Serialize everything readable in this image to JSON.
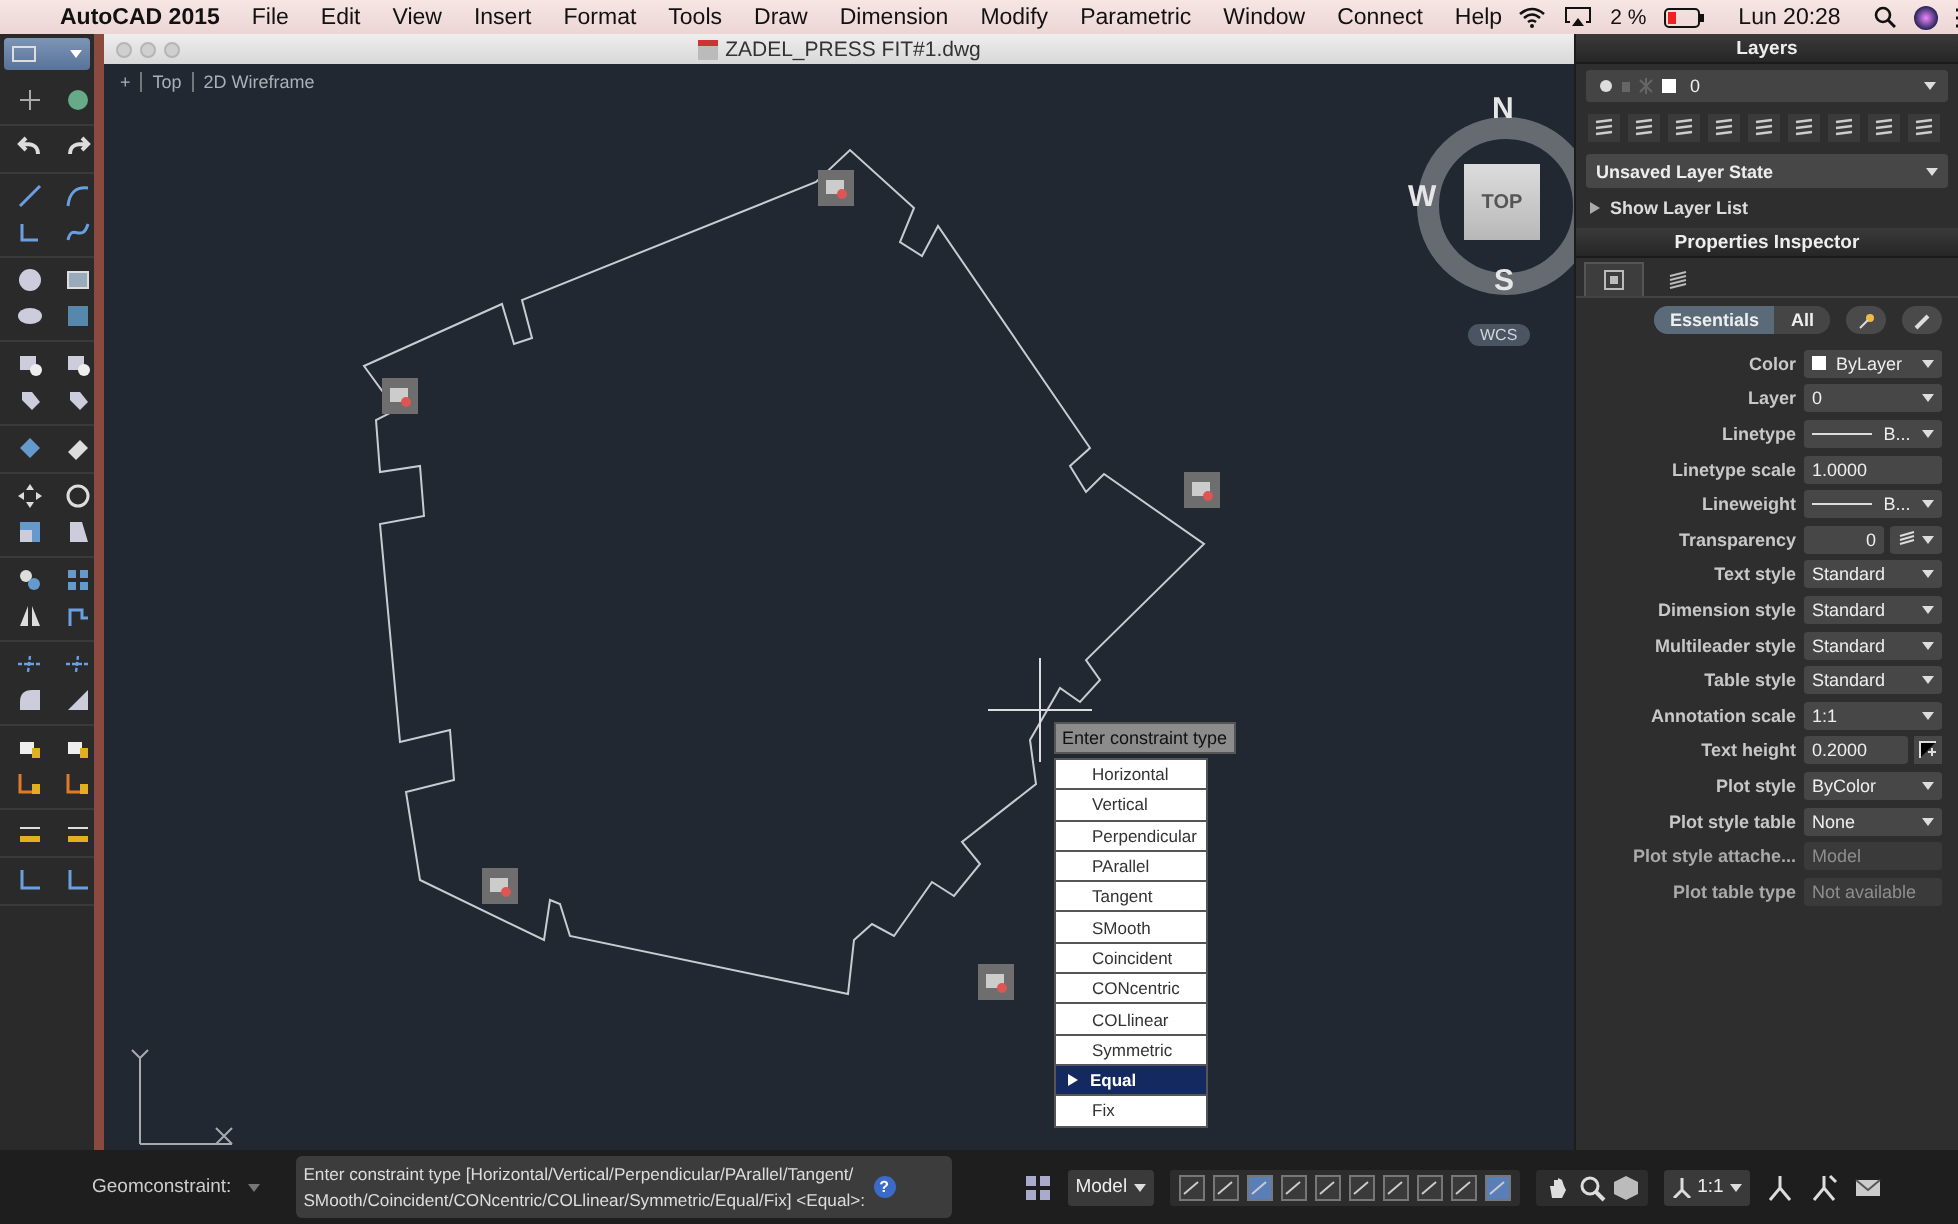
{
  "menu_bar": {
    "app_name": "AutoCAD 2015",
    "items": [
      "File",
      "Edit",
      "View",
      "Insert",
      "Format",
      "Tools",
      "Draw",
      "Dimension",
      "Modify",
      "Parametric",
      "Window",
      "Connect",
      "Help"
    ],
    "battery": "2 %",
    "clock": "Lun 20:28"
  },
  "document": {
    "title": "ZADEL_PRESS FIT#1.dwg",
    "viewport_controls": [
      "+",
      "Top",
      "2D Wireframe"
    ]
  },
  "viewcube": {
    "face": "TOP",
    "north": "N",
    "west": "W",
    "south": "S",
    "coordinate_system": "WCS"
  },
  "constraint_prompt": {
    "label": "Enter constraint type",
    "options": [
      {
        "label": "Horizontal",
        "selected": false
      },
      {
        "label": "Vertical",
        "selected": false
      },
      {
        "label": "Perpendicular",
        "selected": false
      },
      {
        "label": "PArallel",
        "selected": false
      },
      {
        "label": "Tangent",
        "selected": false
      },
      {
        "label": "SMooth",
        "selected": false
      },
      {
        "label": "Coincident",
        "selected": false
      },
      {
        "label": "CONcentric",
        "selected": false
      },
      {
        "label": "COLlinear",
        "selected": false
      },
      {
        "label": "Symmetric",
        "selected": false
      },
      {
        "label": "Equal",
        "selected": true
      },
      {
        "label": "Fix",
        "selected": false
      }
    ]
  },
  "layers_panel": {
    "title": "Layers",
    "current_layer": "0",
    "layer_state": "Unsaved Layer State",
    "show_layer_list": "Show Layer List"
  },
  "properties_inspector": {
    "title": "Properties Inspector",
    "tabs": [
      {
        "selected": true
      },
      {
        "selected": false
      }
    ],
    "modes": [
      {
        "label": "Essentials",
        "selected": true
      },
      {
        "label": "All",
        "selected": false
      }
    ],
    "rows": [
      {
        "label": "Color",
        "value": "ByLayer",
        "kind": "swatch"
      },
      {
        "label": "Layer",
        "value": "0",
        "kind": "dropdown"
      },
      {
        "label": "Linetype",
        "value": "B...",
        "kind": "line"
      },
      {
        "label": "Linetype scale",
        "value": "1.0000",
        "kind": "field"
      },
      {
        "label": "Lineweight",
        "value": "B...",
        "kind": "line"
      },
      {
        "label": "Transparency",
        "value": "0",
        "kind": "transparency"
      },
      {
        "label": "Text style",
        "value": "Standard",
        "kind": "dropdown"
      },
      {
        "label": "Dimension style",
        "value": "Standard",
        "kind": "dropdown"
      },
      {
        "label": "Multileader style",
        "value": "Standard",
        "kind": "dropdown"
      },
      {
        "label": "Table style",
        "value": "Standard",
        "kind": "dropdown"
      },
      {
        "label": "Annotation scale",
        "value": "1:1",
        "kind": "dropdown"
      },
      {
        "label": "Text height",
        "value": "0.2000",
        "kind": "pick"
      },
      {
        "label": "Plot style",
        "value": "ByColor",
        "kind": "dropdown"
      },
      {
        "label": "Plot style table",
        "value": "None",
        "kind": "dropdown"
      },
      {
        "label": "Plot style attache...",
        "value": "Model",
        "kind": "disabled"
      },
      {
        "label": "Plot table type",
        "value": "Not available",
        "kind": "disabled"
      }
    ]
  },
  "command_line": {
    "label": "Geomconstraint:",
    "lines": [
      "Enter constraint type [Horizontal/Vertical/Perpendicular/PArallel/Tangent/",
      "SMooth/Coincident/CONcentric/COLlinear/Symmetric/Equal/Fix] <Equal>:"
    ],
    "help": "?"
  },
  "status_bar": {
    "space": "Model",
    "annotation_scale": "1:1"
  }
}
